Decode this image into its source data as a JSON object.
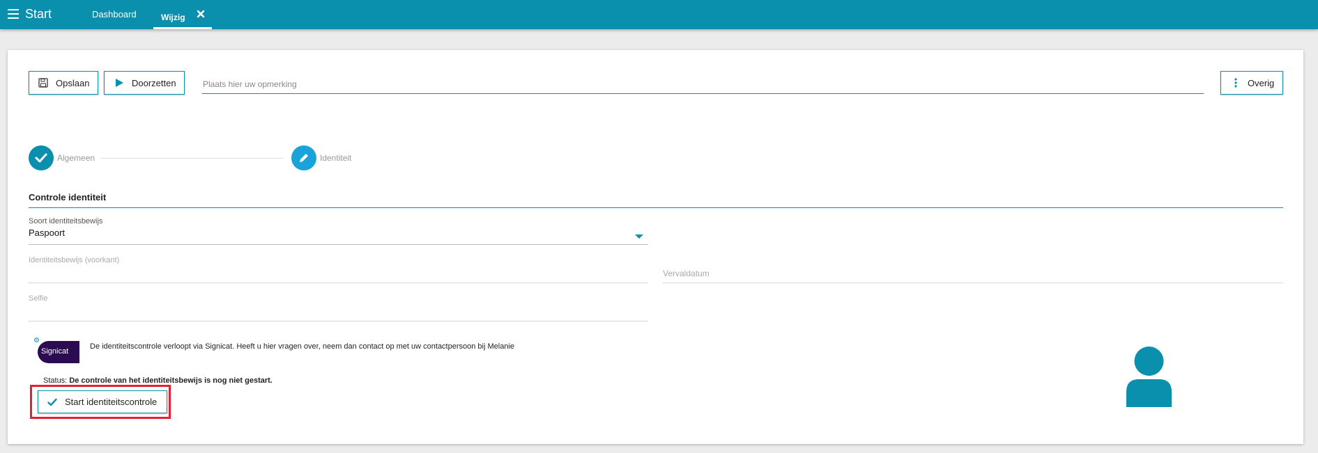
{
  "topbar": {
    "title": "Start",
    "tabs": [
      {
        "label": "Dashboard"
      },
      {
        "label": "Wijzig"
      }
    ]
  },
  "toolbar": {
    "save_label": "Opslaan",
    "forward_label": "Doorzetten",
    "remark_placeholder": "Plaats hier uw opmerking",
    "other_label": "Overig"
  },
  "stepper": {
    "steps": [
      {
        "label": "Algemeen",
        "state": "completed"
      },
      {
        "label": "Identiteit",
        "state": "editing"
      }
    ]
  },
  "section": {
    "title": "Controle identiteit"
  },
  "fields": {
    "id_type_label": "Soort identiteitsbewijs",
    "id_type_value": "Paspoort",
    "id_front_label": "Identiteitsbewijs (voorkant)",
    "expiry_label": "Vervaldatum",
    "selfie_label": "Selfie"
  },
  "signicat": {
    "logo_text": "Signicat",
    "info": "De identiteitscontrole verloopt via Signicat. Heeft u hier vragen over, neem dan contact op met uw contactpersoon bij Melanie",
    "status_label": "Status:",
    "status_value": "De controle van het identiteitsbewijs is nog niet gestart.",
    "start_label": "Start identiteitscontrole"
  },
  "colors": {
    "accent": "#0a8fad",
    "step_edit": "#1aa3d9",
    "highlight": "#e52030",
    "signicat_brand": "#2b0c52"
  },
  "icons": [
    "menu-icon",
    "close-icon",
    "save-icon",
    "play-icon",
    "more-vertical-icon",
    "check-icon",
    "pencil-icon",
    "gear-icon",
    "user-avatar-icon"
  ]
}
